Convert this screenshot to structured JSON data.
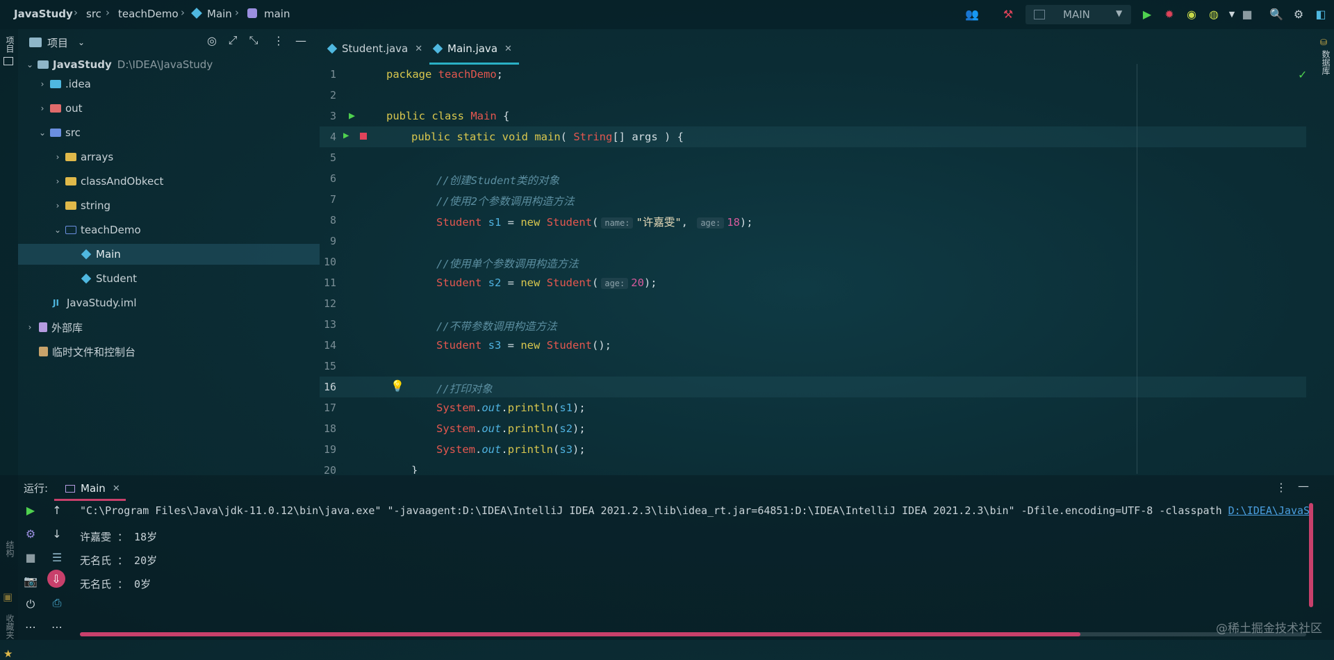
{
  "breadcrumbs": [
    "JavaStudy",
    "src",
    "teachDemo",
    "Main",
    "main"
  ],
  "toolbar": {
    "run_config": "MAIN",
    "colors": {
      "run": "#4fd14f",
      "debug": "#e0435a",
      "accent": "#2ab0c5"
    }
  },
  "left_strip": {
    "project_label": "项目",
    "structure_label": "结构",
    "favorites_label": "收藏夹"
  },
  "right_strip": {
    "database_label": "数据库"
  },
  "project_panel": {
    "title": "项目",
    "tree": [
      {
        "label": "JavaStudy",
        "path": "D:\\IDEA\\JavaStudy",
        "icon": "module-folder-icon"
      },
      {
        "label": ".idea",
        "icon": "idea-folder-icon"
      },
      {
        "label": "out",
        "icon": "excluded-folder-icon"
      },
      {
        "label": "src",
        "icon": "source-folder-icon"
      },
      {
        "label": "arrays",
        "icon": "package-folder-icon"
      },
      {
        "label": "classAndObkect",
        "icon": "package-folder-icon"
      },
      {
        "label": "string",
        "icon": "package-folder-icon"
      },
      {
        "label": "teachDemo",
        "icon": "package-folder-icon"
      },
      {
        "label": "Main",
        "icon": "java-class-icon"
      },
      {
        "label": "Student",
        "icon": "java-class-icon"
      },
      {
        "label": "JavaStudy.iml",
        "icon": "iml-file-icon"
      },
      {
        "label": "外部库",
        "icon": "library-icon"
      },
      {
        "label": "临时文件和控制台",
        "icon": "scratch-icon"
      }
    ]
  },
  "editor": {
    "tabs": [
      {
        "label": "Student.java",
        "active": false
      },
      {
        "label": "Main.java",
        "active": true
      }
    ],
    "line_numbers": [
      "1",
      "2",
      "3",
      "4",
      "5",
      "6",
      "7",
      "8",
      "9",
      "10",
      "11",
      "12",
      "13",
      "14",
      "15",
      "16",
      "17",
      "18",
      "19",
      "20"
    ],
    "code": {
      "l1_kw": "package",
      "l1_pkg": "teachDemo",
      "l3_kw": "public class",
      "l3_cls": "Main",
      "l4_kw": "public static void",
      "l4_fn": "main",
      "l4_type": "String",
      "l4_rest": "[] args ) {",
      "l6": "//创建Student类的对象",
      "l7": "//使用2个参数调用构造方法",
      "l8_type": "Student",
      "l8_var": "s1",
      "l8_new": "new",
      "l8_cls": "Student",
      "l8_hint1": "name:",
      "l8_str": "\"许嘉雯\"",
      "l8_hint2": "age:",
      "l8_num": "18",
      "l10": "//使用单个参数调用构造方法",
      "l11_type": "Student",
      "l11_var": "s2",
      "l11_new": "new",
      "l11_cls": "Student",
      "l11_hint": "age:",
      "l11_num": "20",
      "l13": "//不带参数调用构造方法",
      "l14_type": "Student",
      "l14_var": "s3",
      "l14_new": "new",
      "l14_cls": "Student",
      "l16": "//打印对象",
      "l17_sys": "System",
      "l17_out": "out",
      "l17_fn": "println",
      "l17_arg": "s1",
      "l18_sys": "System",
      "l18_out": "out",
      "l18_fn": "println",
      "l18_arg": "s2",
      "l19_sys": "System",
      "l19_out": "out",
      "l19_fn": "println",
      "l19_arg": "s3",
      "l20": "}"
    }
  },
  "run_panel": {
    "label": "运行:",
    "tab": "Main",
    "command": "\"C:\\Program Files\\Java\\jdk-11.0.12\\bin\\java.exe\" \"-javaagent:D:\\IDEA\\IntelliJ IDEA 2021.2.3\\lib\\idea_rt.jar=64851:D:\\IDEA\\IntelliJ IDEA 2021.2.3\\bin\" -Dfile.encoding=UTF-8 -classpath ",
    "classpath_link": "D:\\IDEA\\JavaS",
    "output": [
      "许嘉雯 ： 18岁",
      "无名氏 ： 20岁",
      "无名氏 ： 0岁"
    ]
  },
  "watermark": "@稀土掘金技术社区"
}
